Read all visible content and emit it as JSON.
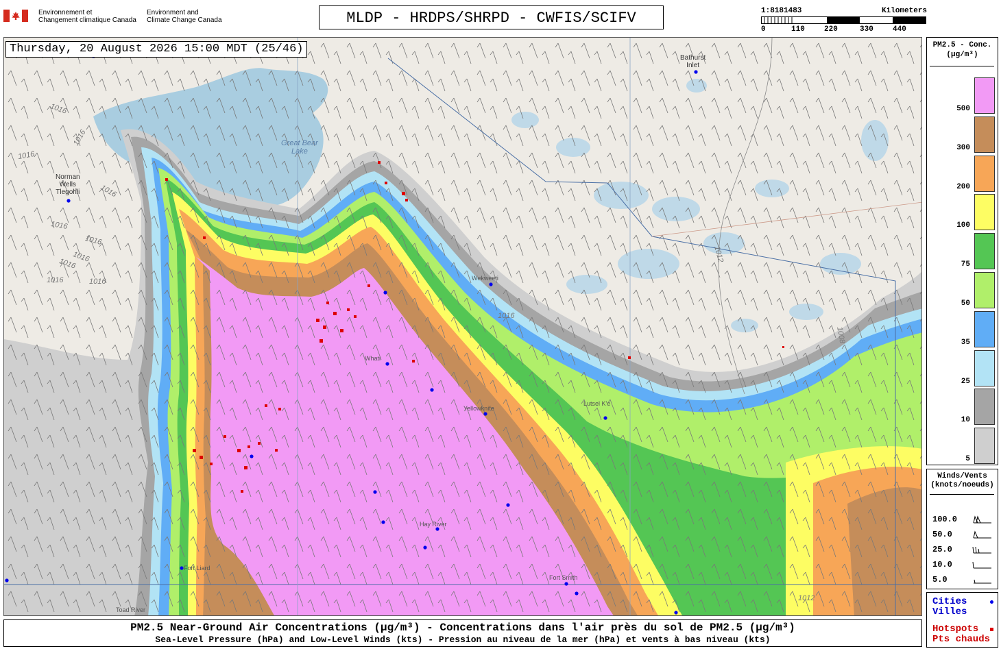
{
  "header": {
    "agency_fr": [
      "Environnement et",
      "Changement climatique Canada"
    ],
    "agency_en": [
      "Environment and",
      "Climate Change Canada"
    ],
    "title": "MLDP - HRDPS/SHRPD - CWFIS/SCIFV"
  },
  "scale": {
    "ratio": "1:8181483",
    "units": "Kilometers",
    "ticks": [
      "0",
      "110",
      "220",
      "330",
      "440"
    ]
  },
  "timestamp": "Thursday, 20 August 2026 15:00 MDT (25/46)",
  "map": {
    "places": {
      "norman_wells": [
        "Norman",
        "Wells",
        "Tlegohli"
      ],
      "bathurst_inlet": [
        "Bathurst",
        "Inlet"
      ],
      "great_bear_lake": [
        "Great Bear",
        "Lake"
      ],
      "fort_smith": "Fort Smith",
      "fort_liard": "Fort Liard",
      "toad_river": "Toad River",
      "hay_river": "Hay River",
      "yellowknife": "Yellowknife",
      "whati": "Whati",
      "wekweeti": "Wekweeti",
      "lutselke": "Lutsel K'e"
    },
    "isobars": [
      "1016",
      "1016",
      "1016",
      "1016",
      "1016",
      "1016",
      "1016",
      "1016",
      "1016",
      "1016",
      "1012",
      "1016",
      "1012",
      "1008"
    ],
    "colors": {
      "land": "#eeebe5",
      "water": "#bfd9e8",
      "lake": "#a9cde0"
    }
  },
  "legend_pm": {
    "header": [
      "PM2.5 - Conc.",
      "(µg/m³)"
    ],
    "levels": [
      {
        "label": "500",
        "color": "#f29af5"
      },
      {
        "label": "300",
        "color": "#c58d5a"
      },
      {
        "label": "200",
        "color": "#f7a657"
      },
      {
        "label": "100",
        "color": "#fdfd63"
      },
      {
        "label": "75",
        "color": "#54c654"
      },
      {
        "label": "50",
        "color": "#b0ef6a"
      },
      {
        "label": "35",
        "color": "#60adf6"
      },
      {
        "label": "25",
        "color": "#b2e3f5"
      },
      {
        "label": "10",
        "color": "#a5a5a5"
      },
      {
        "label": "5",
        "color": "#cfcfcf"
      }
    ]
  },
  "legend_wind": {
    "header": [
      "Winds/Vents",
      "(knots/noeuds)"
    ],
    "rows": [
      "100.0",
      "50.0",
      "25.0",
      "10.0",
      "5.0"
    ]
  },
  "legend_points": {
    "cities": [
      "Cities",
      "Villes"
    ],
    "hotspots": [
      "Hotspots",
      "Pts chauds"
    ],
    "city_color": "#0000ee",
    "hotspot_color": "#dd0000"
  },
  "caption": {
    "line1": "PM2.5 Near-Ground Air Concentrations (µg/m³) - Concentrations dans l'air près du sol de PM2.5 (µg/m³)",
    "line2": "Sea-Level Pressure (hPa) and Low-Level Winds (kts) - Pression au niveau de la mer (hPa) et vents à bas niveau (kts)"
  }
}
